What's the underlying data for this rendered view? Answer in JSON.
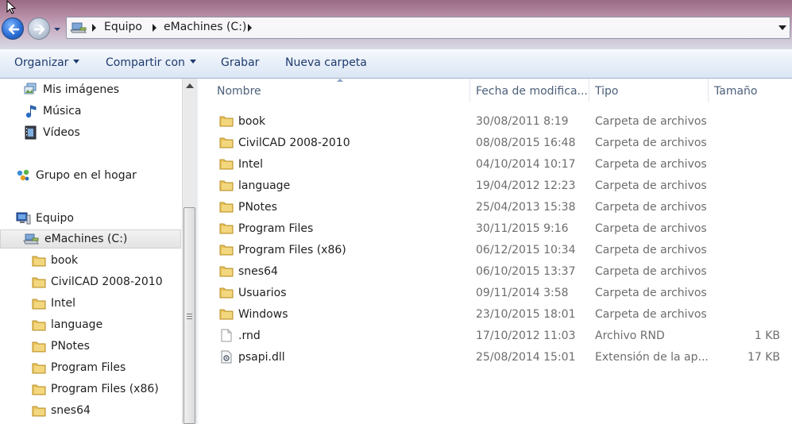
{
  "address_bar": {
    "crumbs": [
      "Equipo",
      "eMachines (C:)"
    ]
  },
  "toolbar": {
    "organize_label": "Organizar",
    "share_label": "Compartir con",
    "burn_label": "Grabar",
    "new_folder_label": "Nueva carpeta"
  },
  "nav": {
    "libraries": [
      {
        "label": "Mis imágenes",
        "icon": "pictures-icon"
      },
      {
        "label": "Música",
        "icon": "music-icon"
      },
      {
        "label": "Vídeos",
        "icon": "videos-icon"
      }
    ],
    "homegroup": {
      "label": "Grupo en el hogar",
      "icon": "homegroup-icon"
    },
    "computer": {
      "label": "Equipo",
      "icon": "computer-icon"
    },
    "drive": {
      "label": "eMachines (C:)",
      "icon": "drive-icon"
    },
    "folders": [
      "book",
      "CivilCAD 2008-2010",
      "Intel",
      "language",
      "PNotes",
      "Program Files",
      "Program Files (x86)",
      "snes64"
    ]
  },
  "columns": {
    "name": "Nombre",
    "date": "Fecha de modifica...",
    "type": "Tipo",
    "size": "Tamaño"
  },
  "files": [
    {
      "name": "book",
      "date": "30/08/2011 8:19",
      "type": "Carpeta de archivos",
      "size": "",
      "icon": "folder-icon"
    },
    {
      "name": "CivilCAD 2008-2010",
      "date": "08/08/2015 16:48",
      "type": "Carpeta de archivos",
      "size": "",
      "icon": "folder-icon"
    },
    {
      "name": "Intel",
      "date": "04/10/2014 10:17",
      "type": "Carpeta de archivos",
      "size": "",
      "icon": "folder-icon"
    },
    {
      "name": "language",
      "date": "19/04/2012 12:23",
      "type": "Carpeta de archivos",
      "size": "",
      "icon": "folder-icon"
    },
    {
      "name": "PNotes",
      "date": "25/04/2013 15:38",
      "type": "Carpeta de archivos",
      "size": "",
      "icon": "folder-icon"
    },
    {
      "name": "Program Files",
      "date": "30/11/2015 9:16",
      "type": "Carpeta de archivos",
      "size": "",
      "icon": "folder-icon"
    },
    {
      "name": "Program Files (x86)",
      "date": "06/12/2015 10:34",
      "type": "Carpeta de archivos",
      "size": "",
      "icon": "folder-icon"
    },
    {
      "name": "snes64",
      "date": "06/10/2015 13:37",
      "type": "Carpeta de archivos",
      "size": "",
      "icon": "folder-icon"
    },
    {
      "name": "Usuarios",
      "date": "09/11/2014 3:58",
      "type": "Carpeta de archivos",
      "size": "",
      "icon": "folder-icon"
    },
    {
      "name": "Windows",
      "date": "23/10/2015 18:01",
      "type": "Carpeta de archivos",
      "size": "",
      "icon": "folder-icon"
    },
    {
      "name": ".rnd",
      "date": "17/10/2012 11:03",
      "type": "Archivo RND",
      "size": "1 KB",
      "icon": "file-icon"
    },
    {
      "name": "psapi.dll",
      "date": "25/08/2014 15:01",
      "type": "Extensión de la ap...",
      "size": "17 KB",
      "icon": "dll-icon"
    }
  ],
  "colors": {
    "toolbar_text": "#1e3a6e",
    "folder": "#e8c25a",
    "secondary_text": "#6d6d6d"
  }
}
